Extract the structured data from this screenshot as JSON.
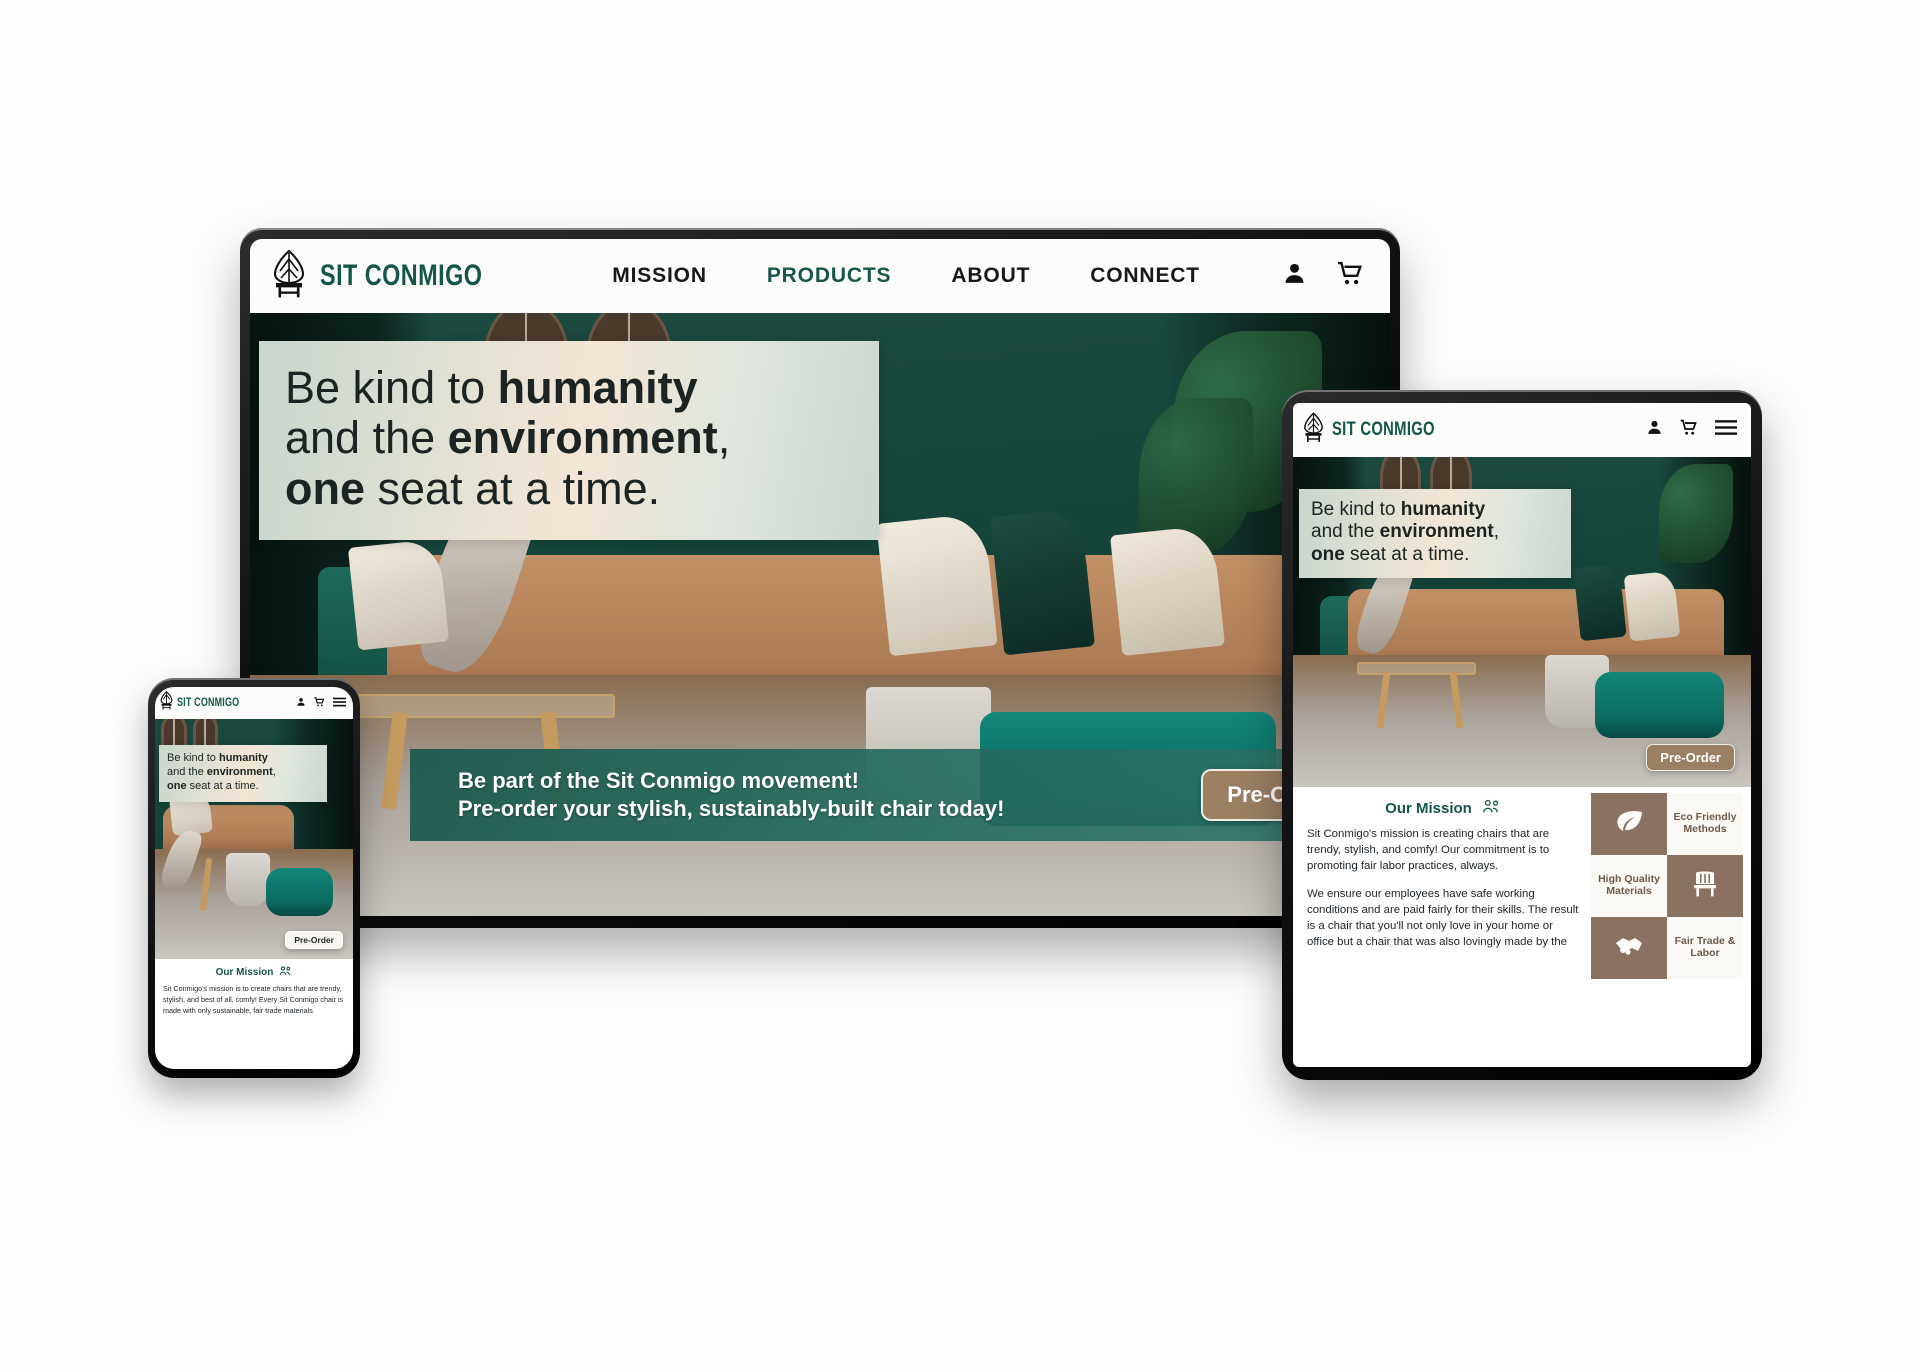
{
  "brand": {
    "name": "SIT CONMIGO",
    "logo_icon": "leaf-chair-logo-icon",
    "accent_green": "#14564a"
  },
  "desktop": {
    "nav": {
      "links": [
        {
          "label": "MISSION",
          "active": false
        },
        {
          "label": "PRODUCTS",
          "active": true
        },
        {
          "label": "ABOUT",
          "active": false
        },
        {
          "label": "CONNECT",
          "active": false
        }
      ],
      "icons": [
        {
          "name": "account-icon",
          "glyph": "person"
        },
        {
          "name": "cart-icon",
          "glyph": "cart"
        }
      ]
    },
    "hero": {
      "headline_lines": [
        {
          "parts": [
            {
              "t": "Be kind to ",
              "b": false
            },
            {
              "t": "humanity",
              "b": true
            }
          ]
        },
        {
          "parts": [
            {
              "t": "and the ",
              "b": false
            },
            {
              "t": "environment",
              "b": true
            },
            {
              "t": ",",
              "b": false
            }
          ]
        },
        {
          "parts": [
            {
              "t": "one",
              "b": true
            },
            {
              "t": " seat at a time.",
              "b": false
            }
          ]
        }
      ]
    },
    "cta": {
      "line1": "Be part of the Sit Conmigo movement!",
      "line2": "Pre-order your stylish, sustainably-built chair today!",
      "button": "Pre-Order"
    }
  },
  "tablet": {
    "nav": {
      "icons": [
        {
          "name": "account-icon",
          "glyph": "person"
        },
        {
          "name": "cart-icon",
          "glyph": "cart"
        },
        {
          "name": "hamburger-menu-icon",
          "glyph": "menu"
        }
      ]
    },
    "hero": {
      "headline_lines": [
        {
          "parts": [
            {
              "t": "Be kind to ",
              "b": false
            },
            {
              "t": "humanity",
              "b": true
            }
          ]
        },
        {
          "parts": [
            {
              "t": "and the ",
              "b": false
            },
            {
              "t": "environment",
              "b": true
            },
            {
              "t": ",",
              "b": false
            }
          ]
        },
        {
          "parts": [
            {
              "t": "one",
              "b": true
            },
            {
              "t": " seat at a time.",
              "b": false
            }
          ]
        }
      ],
      "button": "Pre-Order"
    },
    "mission": {
      "title": "Our Mission",
      "title_icon": "people-group-icon",
      "paragraph1": "Sit Conmigo's mission is creating chairs that are trendy, stylish, and comfy! Our commitment is to promoting fair labor practices, always.",
      "paragraph2": "We ensure our employees have safe working conditions and are paid fairly for their skills. The result is a chair that you'll not only love in your home or office but a chair that was also lovingly made by the"
    },
    "features": [
      {
        "kind": "icon",
        "icon": "leaf-icon",
        "style": "brown"
      },
      {
        "kind": "text",
        "label": "Eco Friendly Methods",
        "style": "cream"
      },
      {
        "kind": "text",
        "label": "High Quality Materials",
        "style": "cream"
      },
      {
        "kind": "icon",
        "icon": "chair-icon",
        "style": "brown"
      },
      {
        "kind": "icon",
        "icon": "handshake-icon",
        "style": "brown"
      },
      {
        "kind": "text",
        "label": "Fair Trade & Labor",
        "style": "cream"
      }
    ]
  },
  "phone": {
    "nav": {
      "icons": [
        {
          "name": "account-icon",
          "glyph": "person"
        },
        {
          "name": "cart-icon",
          "glyph": "cart"
        },
        {
          "name": "hamburger-menu-icon",
          "glyph": "menu"
        }
      ]
    },
    "hero": {
      "headline_lines": [
        {
          "parts": [
            {
              "t": "Be kind to ",
              "b": false
            },
            {
              "t": "humanity",
              "b": true
            }
          ]
        },
        {
          "parts": [
            {
              "t": "and the ",
              "b": false
            },
            {
              "t": "environment",
              "b": true
            },
            {
              "t": ",",
              "b": false
            }
          ]
        },
        {
          "parts": [
            {
              "t": "one",
              "b": true
            },
            {
              "t": " seat at a time.",
              "b": false
            }
          ]
        }
      ],
      "button": "Pre-Order"
    },
    "mission": {
      "title": "Our Mission",
      "title_icon": "people-group-icon",
      "paragraph1": "Sit Conmigo's mission is to create chairs that are trendy, stylish, and best of all, comfy! Every Sit Conmigo chair is made with only sustainable, fair trade materials"
    }
  },
  "palette": {
    "brand_green": "#14564a",
    "cta_green": "#1f6a5c",
    "brown": "#8b7260",
    "cream": "#fbf9f5",
    "wall_green": "#16473c",
    "sofa_tan": "#b07e56",
    "ottoman_teal": "#0c6a5f"
  }
}
